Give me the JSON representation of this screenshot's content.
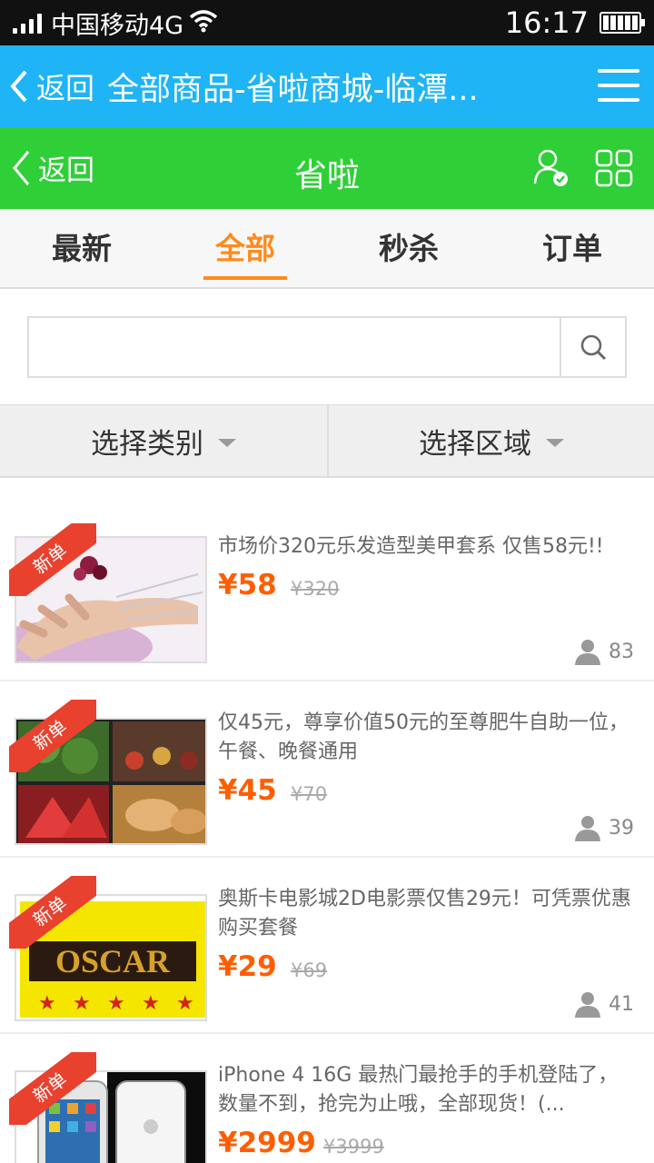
{
  "status_bar": {
    "carrier": "中国移动4G",
    "time": "16:17"
  },
  "browser": {
    "back_label": "返回",
    "title": "全部商品-省啦商城-临潭..."
  },
  "header": {
    "back_label": "返回",
    "title": "省啦"
  },
  "tabs": [
    {
      "label": "最新"
    },
    {
      "label": "全部"
    },
    {
      "label": "秒杀"
    },
    {
      "label": "订单"
    }
  ],
  "search": {
    "value": "",
    "placeholder": ""
  },
  "filters": [
    {
      "label": "选择类别"
    },
    {
      "label": "选择区域"
    }
  ],
  "items": [
    {
      "badge": "新单",
      "title": "市场价320元乐发造型美甲套系 仅售58元!!",
      "price": "¥58",
      "original_price": "¥320",
      "buyers": "83",
      "image": "nail-art-photo"
    },
    {
      "badge": "新单",
      "title": "仅45元，尊享价值50元的至尊肥牛自助一位，午餐、晚餐通用",
      "price": "¥45",
      "original_price": "¥70",
      "buyers": "39",
      "image": "buffet-food-photo"
    },
    {
      "badge": "新单",
      "title": "奥斯卡电影城2D电影票仅售29元！可凭票优惠购买套餐",
      "price": "¥29",
      "original_price": "¥69",
      "buyers": "41",
      "image": "oscar-logo",
      "logo_text": "OSCAR"
    },
    {
      "badge": "新单",
      "title": "iPhone 4 16G 最热门最抢手的手机登陆了，数量不到，抢完为止哦，全部现货！(...",
      "price": "¥2999",
      "original_price": "¥3999",
      "buyers": "",
      "image": "iphone-photo"
    }
  ],
  "colors": {
    "browser_bar": "#1eb4f5",
    "app_header": "#2fcf37",
    "accent": "#ff8a1c",
    "price": "#ff5e00",
    "ribbon": "#e8412e"
  }
}
